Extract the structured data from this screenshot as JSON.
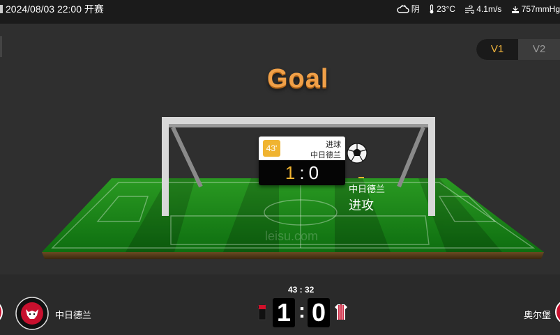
{
  "header": {
    "datetime_text": "2024/08/03 22:00 开赛",
    "weather": {
      "icon": "cloudy-icon",
      "text": "阴"
    },
    "temperature": {
      "icon": "thermometer-icon",
      "text": "23°C"
    },
    "wind": {
      "icon": "wind-icon",
      "text": "4.1m/s"
    },
    "pressure": {
      "icon": "pressure-icon",
      "text": "757mmHg"
    }
  },
  "view_toggle": {
    "options": [
      "V1",
      "V2"
    ],
    "selected": "V1"
  },
  "animation": {
    "title": "Goal",
    "watermark": "leisu.com",
    "event_card": {
      "minute": "43'",
      "type": "进球",
      "team": "中日德兰",
      "score_home": "1",
      "score_separator": ":",
      "score_away": "0"
    },
    "annotation": {
      "team": "中日德兰",
      "action": "进攻"
    }
  },
  "match": {
    "time": "43 : 32",
    "home": {
      "name": "中日德兰",
      "score": "1"
    },
    "away": {
      "name": "奥尔堡",
      "score": "0"
    },
    "score_separator": ":"
  },
  "colors": {
    "accent": "#f0b431",
    "goal_title": "#f0a048",
    "pitch": "#1f8a18",
    "background": "#2f2f2f"
  }
}
